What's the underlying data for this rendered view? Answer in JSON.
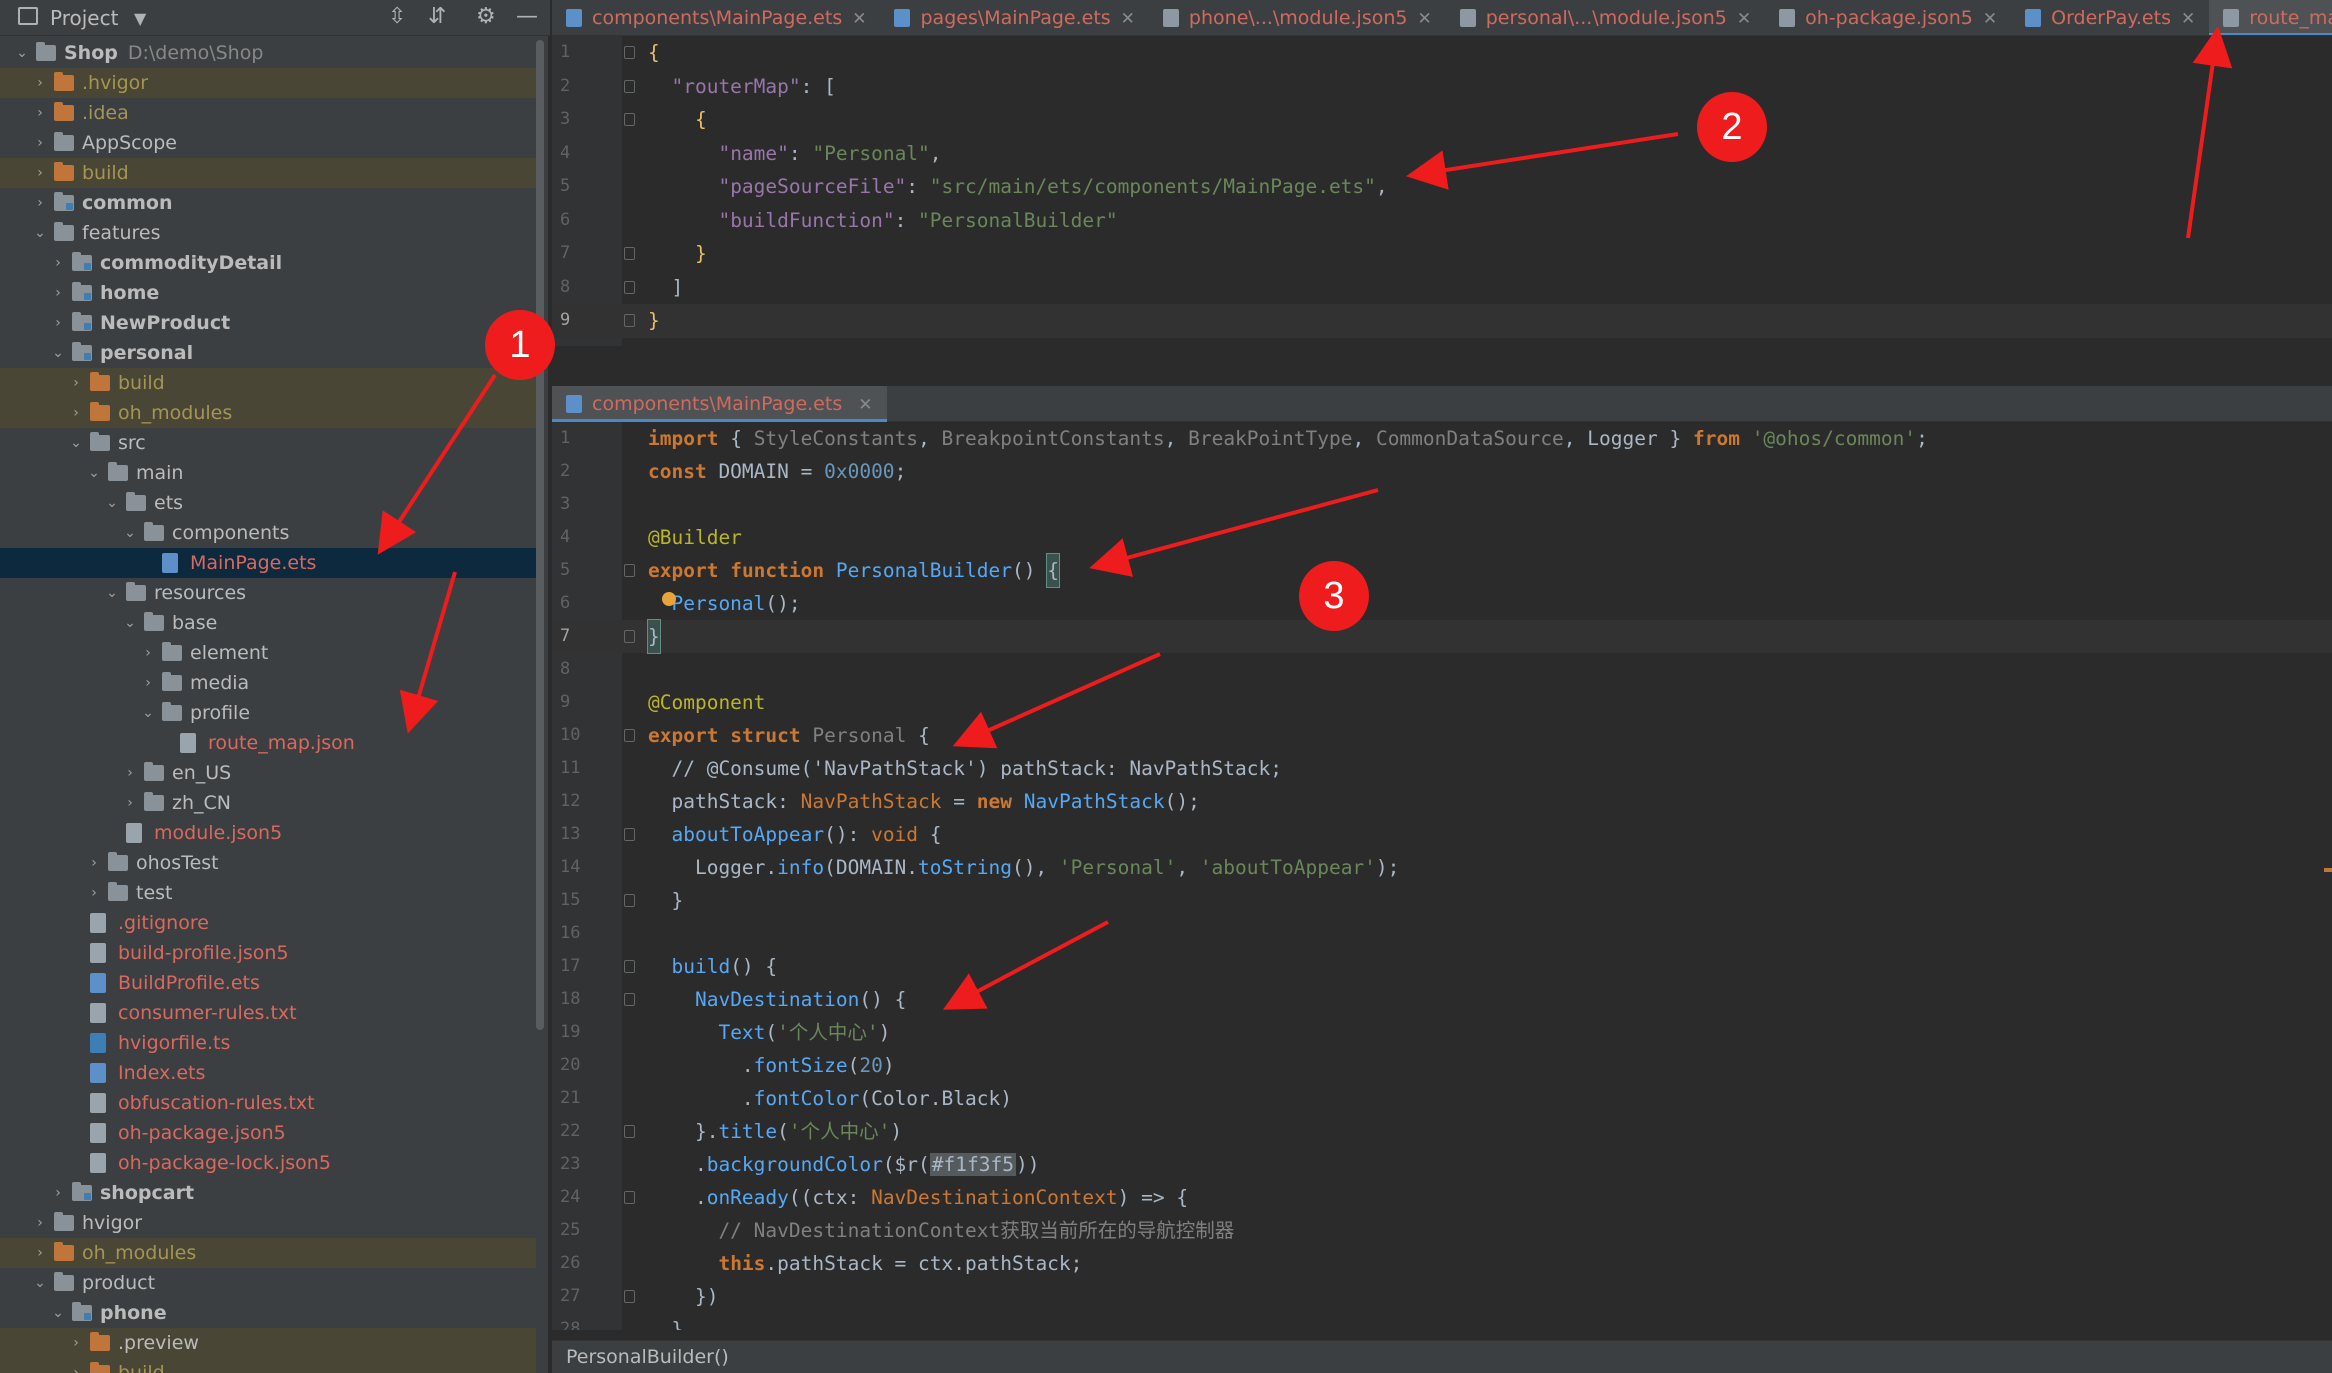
{
  "project_panel": {
    "title": "Project",
    "tree": [
      {
        "label": "Shop",
        "sub": "D:\\demo\\Shop",
        "depth": 0,
        "arrow": "down",
        "icon": "folder",
        "style": "b"
      },
      {
        "label": ".hvigor",
        "depth": 1,
        "arrow": "right",
        "icon": "folder-orange",
        "style": "ol",
        "hl": true
      },
      {
        "label": ".idea",
        "depth": 1,
        "arrow": "right",
        "icon": "folder-orange",
        "style": "ol"
      },
      {
        "label": "AppScope",
        "depth": 1,
        "arrow": "right",
        "icon": "folder"
      },
      {
        "label": "build",
        "depth": 1,
        "arrow": "right",
        "icon": "folder-orange",
        "style": "ol",
        "hl": true
      },
      {
        "label": "common",
        "depth": 1,
        "arrow": "right",
        "icon": "folder-mod",
        "style": "b"
      },
      {
        "label": "features",
        "depth": 1,
        "arrow": "down",
        "icon": "folder"
      },
      {
        "label": "commodityDetail",
        "depth": 2,
        "arrow": "right",
        "icon": "folder-mod",
        "style": "b"
      },
      {
        "label": "home",
        "depth": 2,
        "arrow": "right",
        "icon": "folder-mod",
        "style": "b"
      },
      {
        "label": "NewProduct",
        "depth": 2,
        "arrow": "right",
        "icon": "folder-mod",
        "style": "b"
      },
      {
        "label": "personal",
        "depth": 2,
        "arrow": "down",
        "icon": "folder-mod",
        "style": "b"
      },
      {
        "label": "build",
        "depth": 3,
        "arrow": "right",
        "icon": "folder-orange",
        "style": "ol",
        "hl": true
      },
      {
        "label": "oh_modules",
        "depth": 3,
        "arrow": "right",
        "icon": "folder-orange",
        "style": "ol",
        "hl": true
      },
      {
        "label": "src",
        "depth": 3,
        "arrow": "down",
        "icon": "folder"
      },
      {
        "label": "main",
        "depth": 4,
        "arrow": "down",
        "icon": "folder"
      },
      {
        "label": "ets",
        "depth": 5,
        "arrow": "down",
        "icon": "folder"
      },
      {
        "label": "components",
        "depth": 6,
        "arrow": "down",
        "icon": "folder"
      },
      {
        "label": "MainPage.ets",
        "depth": 7,
        "arrow": "none",
        "icon": "file-ets",
        "style": "red",
        "sel": true
      },
      {
        "label": "resources",
        "depth": 5,
        "arrow": "down",
        "icon": "folder"
      },
      {
        "label": "base",
        "depth": 6,
        "arrow": "down",
        "icon": "folder"
      },
      {
        "label": "element",
        "depth": 7,
        "arrow": "right",
        "icon": "folder"
      },
      {
        "label": "media",
        "depth": 7,
        "arrow": "right",
        "icon": "folder"
      },
      {
        "label": "profile",
        "depth": 7,
        "arrow": "down",
        "icon": "folder"
      },
      {
        "label": "route_map.json",
        "depth": 8,
        "arrow": "none",
        "icon": "file",
        "style": "red"
      },
      {
        "label": "en_US",
        "depth": 6,
        "arrow": "right",
        "icon": "folder"
      },
      {
        "label": "zh_CN",
        "depth": 6,
        "arrow": "right",
        "icon": "folder"
      },
      {
        "label": "module.json5",
        "depth": 5,
        "arrow": "none",
        "icon": "file",
        "style": "red"
      },
      {
        "label": "ohosTest",
        "depth": 4,
        "arrow": "right",
        "icon": "folder"
      },
      {
        "label": "test",
        "depth": 4,
        "arrow": "right",
        "icon": "folder"
      },
      {
        "label": ".gitignore",
        "depth": 3,
        "arrow": "none",
        "icon": "file",
        "style": "red"
      },
      {
        "label": "build-profile.json5",
        "depth": 3,
        "arrow": "none",
        "icon": "file",
        "style": "red"
      },
      {
        "label": "BuildProfile.ets",
        "depth": 3,
        "arrow": "none",
        "icon": "file-ets",
        "style": "red"
      },
      {
        "label": "consumer-rules.txt",
        "depth": 3,
        "arrow": "none",
        "icon": "file",
        "style": "red"
      },
      {
        "label": "hvigorfile.ts",
        "depth": 3,
        "arrow": "none",
        "icon": "file-ts",
        "style": "red"
      },
      {
        "label": "Index.ets",
        "depth": 3,
        "arrow": "none",
        "icon": "file-ets",
        "style": "red"
      },
      {
        "label": "obfuscation-rules.txt",
        "depth": 3,
        "arrow": "none",
        "icon": "file",
        "style": "red"
      },
      {
        "label": "oh-package.json5",
        "depth": 3,
        "arrow": "none",
        "icon": "file",
        "style": "red"
      },
      {
        "label": "oh-package-lock.json5",
        "depth": 3,
        "arrow": "none",
        "icon": "file",
        "style": "red"
      },
      {
        "label": "shopcart",
        "depth": 2,
        "arrow": "right",
        "icon": "folder-mod",
        "style": "b"
      },
      {
        "label": "hvigor",
        "depth": 1,
        "arrow": "right",
        "icon": "folder"
      },
      {
        "label": "oh_modules",
        "depth": 1,
        "arrow": "right",
        "icon": "folder-orange",
        "style": "ol",
        "hl": true
      },
      {
        "label": "product",
        "depth": 1,
        "arrow": "down",
        "icon": "folder"
      },
      {
        "label": "phone",
        "depth": 2,
        "arrow": "down",
        "icon": "folder-mod",
        "style": "b"
      },
      {
        "label": ".preview",
        "depth": 3,
        "arrow": "right",
        "icon": "folder-orange",
        "style": "",
        "hl": true
      },
      {
        "label": "build",
        "depth": 3,
        "arrow": "right",
        "icon": "folder-orange",
        "style": "ol",
        "hl": true
      }
    ]
  },
  "tabs": [
    {
      "label": "components\\MainPage.ets",
      "icon": "ets"
    },
    {
      "label": "pages\\MainPage.ets",
      "icon": "ets"
    },
    {
      "label": "phone\\...\\module.json5",
      "icon": "json"
    },
    {
      "label": "personal\\...\\module.json5",
      "icon": "json"
    },
    {
      "label": "oh-package.json5",
      "icon": "json"
    },
    {
      "label": "OrderPay.ets",
      "icon": "ets"
    },
    {
      "label": "route_map.json",
      "icon": "json",
      "active": true
    }
  ],
  "pane2_tab": {
    "label": "components\\MainPage.ets"
  },
  "json_lines": [
    [
      [
        "{",
        "y"
      ]
    ],
    [
      [
        "  ",
        ""
      ],
      [
        "\"routerMap\"",
        "p"
      ],
      [
        ": [",
        ""
      ]
    ],
    [
      [
        "    {",
        "y"
      ]
    ],
    [
      [
        "      ",
        ""
      ],
      [
        "\"name\"",
        "p"
      ],
      [
        ": ",
        ""
      ],
      [
        "\"Personal\"",
        "s"
      ],
      [
        ",",
        ""
      ]
    ],
    [
      [
        "      ",
        ""
      ],
      [
        "\"pageSourceFile\"",
        "p"
      ],
      [
        ": ",
        ""
      ],
      [
        "\"src/main/ets/components/MainPage.ets\"",
        "s"
      ],
      [
        ",",
        ""
      ]
    ],
    [
      [
        "      ",
        ""
      ],
      [
        "\"buildFunction\"",
        "p"
      ],
      [
        ": ",
        ""
      ],
      [
        "\"PersonalBuilder\"",
        "s"
      ]
    ],
    [
      [
        "    }",
        "y"
      ]
    ],
    [
      [
        "  ]",
        ""
      ]
    ],
    [
      [
        "}",
        "y"
      ]
    ]
  ],
  "code_lines": [
    [
      [
        "import",
        "k"
      ],
      [
        " { ",
        ""
      ],
      [
        "StyleConstants",
        "c"
      ],
      [
        ", ",
        ""
      ],
      [
        "BreakpointConstants",
        "c"
      ],
      [
        ", ",
        ""
      ],
      [
        "BreakPointType",
        "c"
      ],
      [
        ", ",
        ""
      ],
      [
        "CommonDataSource",
        "c"
      ],
      [
        ", ",
        ""
      ],
      [
        "Logger",
        ""
      ],
      [
        " } ",
        ""
      ],
      [
        "from",
        "k"
      ],
      [
        " ",
        ""
      ],
      [
        "'@ohos/common'",
        "s"
      ],
      [
        ";",
        ""
      ]
    ],
    [
      [
        "const",
        "k"
      ],
      [
        " DOMAIN = ",
        ""
      ],
      [
        "0x0000",
        "n"
      ],
      [
        ";",
        ""
      ]
    ],
    [],
    [
      [
        "@Builder",
        "a"
      ]
    ],
    [
      [
        "export",
        "k"
      ],
      [
        " ",
        ""
      ],
      [
        "function",
        "k"
      ],
      [
        " ",
        ""
      ],
      [
        "PersonalBuilder",
        "t"
      ],
      [
        "() ",
        ""
      ],
      [
        "{",
        "cb"
      ]
    ],
    [
      [
        "  ",
        ""
      ],
      [
        "Personal",
        "t"
      ],
      [
        "();",
        ""
      ]
    ],
    [
      [
        "}",
        "cb"
      ]
    ],
    [],
    [
      [
        "@Component",
        "a"
      ]
    ],
    [
      [
        "export",
        "k"
      ],
      [
        " ",
        ""
      ],
      [
        "struct",
        "k"
      ],
      [
        " ",
        ""
      ],
      [
        "Personal",
        "c"
      ],
      [
        " {",
        ""
      ]
    ],
    [
      [
        "  // @Consume('NavPathStack') pathStack: NavPathStack;",
        ""
      ]
    ],
    [
      [
        "  pathStack: ",
        ""
      ],
      [
        "NavPathStack",
        "kw"
      ],
      [
        " = ",
        ""
      ],
      [
        "new",
        "k"
      ],
      [
        " ",
        ""
      ],
      [
        "NavPathStack",
        "t"
      ],
      [
        "();",
        ""
      ]
    ],
    [
      [
        "  ",
        ""
      ],
      [
        "aboutToAppear",
        "t"
      ],
      [
        "(): ",
        ""
      ],
      [
        "void",
        "kw"
      ],
      [
        " {",
        ""
      ]
    ],
    [
      [
        "    Logger.",
        ""
      ],
      [
        "info",
        "t"
      ],
      [
        "(DOMAIN.",
        ""
      ],
      [
        "toString",
        "t"
      ],
      [
        "(), ",
        ""
      ],
      [
        "'Personal'",
        "s"
      ],
      [
        ", ",
        ""
      ],
      [
        "'aboutToAppear'",
        "s"
      ],
      [
        ");",
        ""
      ]
    ],
    [
      [
        "  }",
        ""
      ]
    ],
    [],
    [
      [
        "  ",
        ""
      ],
      [
        "build",
        "t"
      ],
      [
        "() {",
        ""
      ]
    ],
    [
      [
        "    ",
        ""
      ],
      [
        "NavDestination",
        "t"
      ],
      [
        "() {",
        ""
      ]
    ],
    [
      [
        "      ",
        ""
      ],
      [
        "Text",
        "t"
      ],
      [
        "(",
        ""
      ],
      [
        "'个人中心'",
        "s"
      ],
      [
        ")",
        ""
      ]
    ],
    [
      [
        "        .",
        ""
      ],
      [
        "fontSize",
        "t"
      ],
      [
        "(",
        ""
      ],
      [
        "20",
        "n"
      ],
      [
        ")",
        ""
      ]
    ],
    [
      [
        "        .",
        ""
      ],
      [
        "fontColor",
        "t"
      ],
      [
        "(Color.Black)",
        ""
      ]
    ],
    [
      [
        "    }.",
        ""
      ],
      [
        "title",
        "t"
      ],
      [
        "(",
        ""
      ],
      [
        "'个人中心'",
        "s"
      ],
      [
        ")",
        ""
      ]
    ],
    [
      [
        "    .",
        ""
      ],
      [
        "backgroundColor",
        "t"
      ],
      [
        "($r(",
        ""
      ],
      [
        "#f1f3f5",
        "hx"
      ],
      [
        "))",
        ""
      ]
    ],
    [
      [
        "    .",
        ""
      ],
      [
        "onReady",
        "t"
      ],
      [
        "((ctx: ",
        ""
      ],
      [
        "NavDestinationContext",
        "kw"
      ],
      [
        ") => {",
        ""
      ]
    ],
    [
      [
        "      // NavDestinationContext获取当前所在的导航控制器",
        "c"
      ]
    ],
    [
      [
        "      ",
        ""
      ],
      [
        "this",
        "k"
      ],
      [
        ".pathStack = ctx.pathStack;",
        ""
      ]
    ],
    [
      [
        "    })",
        ""
      ]
    ],
    [
      [
        "  }",
        ""
      ]
    ]
  ],
  "status": {
    "breadcrumb": "PersonalBuilder()"
  },
  "annotations": [
    "1",
    "2",
    "3"
  ]
}
